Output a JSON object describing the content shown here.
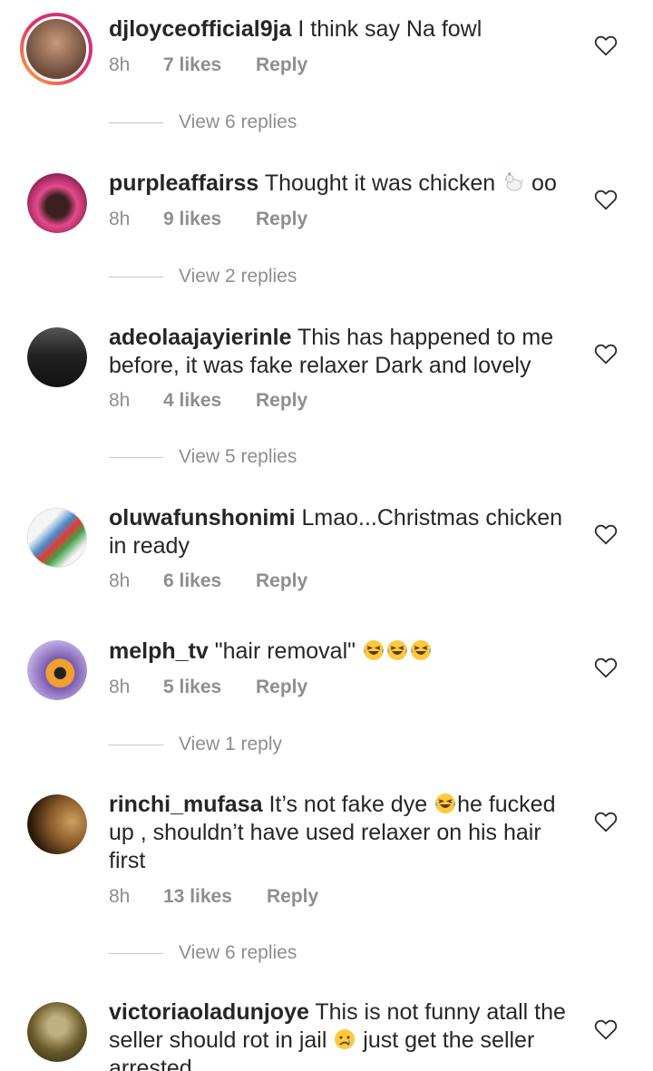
{
  "comments": [
    {
      "username": "djloyceofficial9ja",
      "text": " I think say Na fowl",
      "time": "8h",
      "likes": "7 likes",
      "reply": "Reply",
      "view_replies": "View 6 replies",
      "avatar_colors": [
        "#6b4a3a",
        "#c79a7a"
      ]
    },
    {
      "username": "purpleaffairss",
      "text": " Thought it was chicken",
      "text_after": " oo",
      "emoji": "rooster",
      "time": "8h",
      "likes": "9 likes",
      "reply": "Reply",
      "view_replies": "View 2 replies",
      "avatar_colors": [
        "#7a1a4a",
        "#e64a8a"
      ]
    },
    {
      "username": "adeolaajayierinle",
      "text": " This has happened to me before, it was fake relaxer Dark and lovely",
      "time": "8h",
      "likes": "4 likes",
      "reply": "Reply",
      "view_replies": "View 5 replies",
      "avatar_colors": [
        "#222222",
        "#8a8a8a"
      ]
    },
    {
      "username": "oluwafunshonimi",
      "text": " Lmao...Christmas chicken in ready",
      "time": "8h",
      "likes": "6 likes",
      "reply": "Reply",
      "avatar_colors": [
        "#4a8ac7",
        "#e0e0e0"
      ]
    },
    {
      "username": "melph_tv",
      "text": " \"hair removal\" ",
      "emoji": "laughing-tears x3",
      "time": "8h",
      "likes": "5 likes",
      "reply": "Reply",
      "view_replies": "View 1 reply",
      "avatar_colors": [
        "#7a5ab0",
        "#f0a030"
      ]
    },
    {
      "username": "rinchi_mufasa",
      "text": " It’s not fake dye ",
      "text_after": "he fucked up , shouldn’t have used relaxer on his hair first",
      "emoji": "laughing-tears",
      "time": "8h",
      "likes": "13 likes",
      "reply": "Reply",
      "view_replies": "View 6 replies",
      "avatar_colors": [
        "#5a3a1a",
        "#d0a060"
      ]
    },
    {
      "username": "victoriaoladunjoye",
      "text": " This is not funny atall the seller should rot in jail ",
      "text_after": " just get the seller arrested",
      "emoji": "sad-face",
      "avatar_colors": [
        "#6a5a2a",
        "#c0b080"
      ]
    }
  ],
  "colors": {
    "text": "#262626",
    "secondary": "#8e8e8e",
    "emoji_yellow": "#ffc83d"
  }
}
